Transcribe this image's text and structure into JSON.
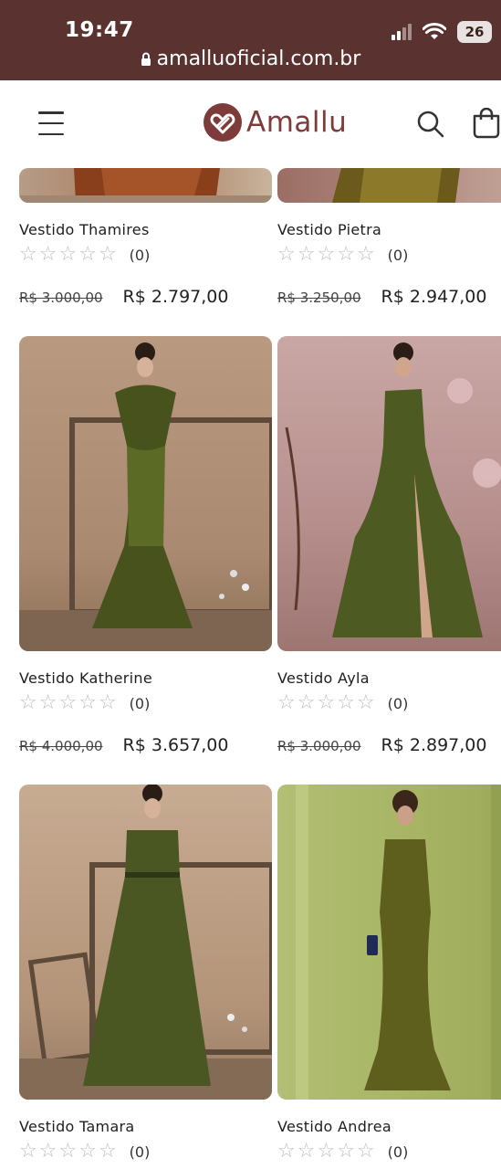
{
  "status_bar": {
    "time": "19:47",
    "battery": "26",
    "url": "amalluoficial.com.br"
  },
  "header": {
    "brand": "Amallu"
  },
  "products": [
    {
      "name": "Vestido Thamires",
      "rating_count": "(0)",
      "old_price": "R$ 3.000,00",
      "price": "R$ 2.797,00"
    },
    {
      "name": "Vestido Pietra",
      "rating_count": "(0)",
      "old_price": "R$ 3.250,00",
      "price": "R$ 2.947,00"
    },
    {
      "name": "Vestido Katherine",
      "rating_count": "(0)",
      "old_price": "R$ 4.000,00",
      "price": "R$ 3.657,00"
    },
    {
      "name": "Vestido Ayla",
      "rating_count": "(0)",
      "old_price": "R$ 3.000,00",
      "price": "R$ 2.897,00"
    },
    {
      "name": "Vestido Tamara",
      "rating_count": "(0)"
    },
    {
      "name": "Vestido Andrea",
      "rating_count": "(0)"
    }
  ],
  "colors": {
    "status_bar": "#5a3331",
    "brand": "#7d3b39",
    "dress_green": "#4d5a22"
  }
}
